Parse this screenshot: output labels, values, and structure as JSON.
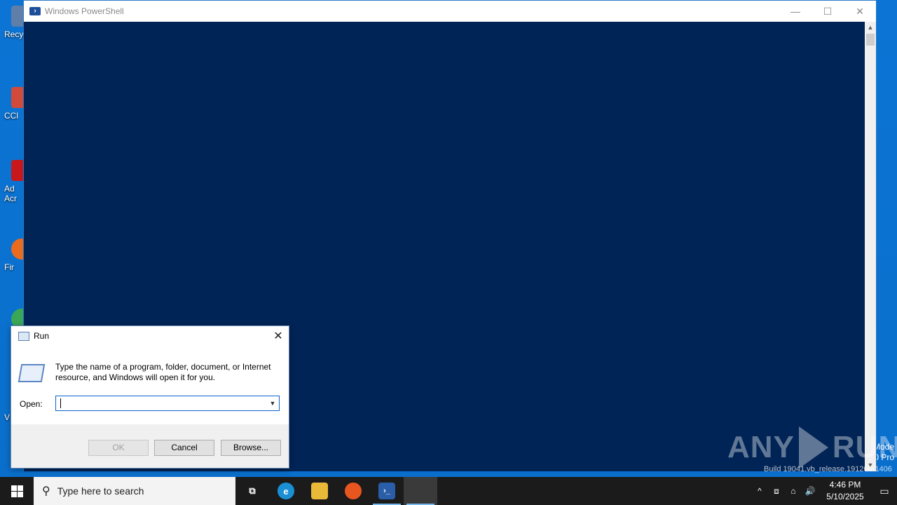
{
  "desktop": {
    "icons": [
      {
        "label": "Recyc",
        "color": "#5f7ea8"
      },
      {
        "label": "CCl",
        "color": "#d24b3a"
      },
      {
        "label": "Ad",
        "label2": "Acr",
        "color": "#c9181b"
      },
      {
        "label": "Fir",
        "color": "#ea6b1e"
      },
      {
        "label": "",
        "color": "#3aa757"
      },
      {
        "label": "V",
        "color": "#888888"
      }
    ],
    "watermark_lines": [
      "Mode",
      "0 Pro"
    ],
    "build_text": "Build 19041.vb_release.191206-1406"
  },
  "powershell": {
    "title": "Windows PowerShell",
    "minimize": "—",
    "maximize": "☐",
    "close": "✕",
    "background": "#012456"
  },
  "anyrun": {
    "left": "ANY",
    "right": "RUN"
  },
  "run_dialog": {
    "title": "Run",
    "close": "✕",
    "description": "Type the name of a program, folder, document, or Internet resource, and Windows will open it for you.",
    "open_label": "Open:",
    "input_value": "",
    "buttons": {
      "ok": "OK",
      "cancel": "Cancel",
      "browse": "Browse..."
    }
  },
  "taskbar": {
    "search_placeholder": "Type here to search",
    "apps": [
      {
        "name": "task-view",
        "glyph": "⧉",
        "color": "#1b1b1b"
      },
      {
        "name": "edge",
        "glyph": "e",
        "color": "#1b8fd4"
      },
      {
        "name": "file-explorer",
        "glyph": "▬",
        "color": "#e9b938"
      },
      {
        "name": "firefox",
        "glyph": "◉",
        "color": "#e8561f"
      },
      {
        "name": "powershell",
        "glyph": "›_",
        "color": "#2b5ea8"
      }
    ],
    "tray": {
      "chevron": "^",
      "net": "⌂",
      "vol": "🔊"
    },
    "time": "4:46 PM",
    "date": "5/10/2025",
    "notification": "▭"
  }
}
